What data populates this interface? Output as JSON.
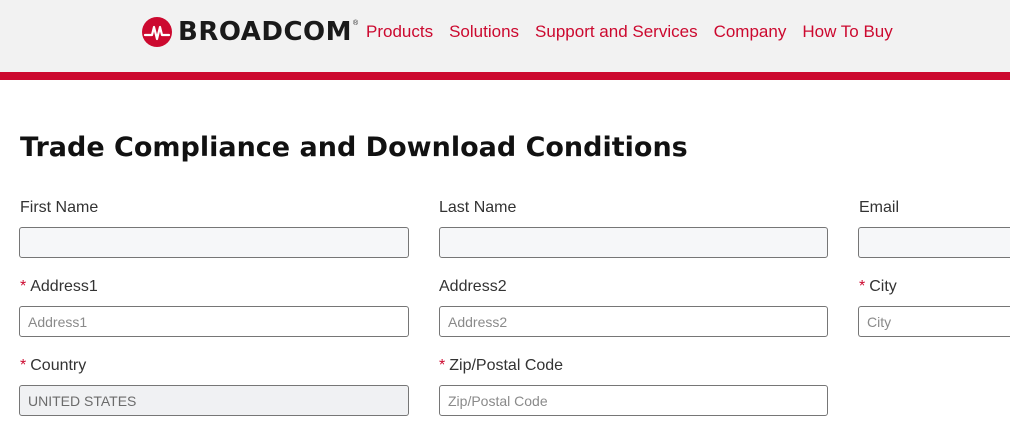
{
  "brand": {
    "name": "BROADCOM",
    "reg": "®",
    "accent": "#cc092f"
  },
  "nav": {
    "items": [
      {
        "label": "Products"
      },
      {
        "label": "Solutions"
      },
      {
        "label": "Support and Services"
      },
      {
        "label": "Company"
      },
      {
        "label": "How To Buy"
      }
    ]
  },
  "page": {
    "title": "Trade Compliance and Download Conditions"
  },
  "form": {
    "required_marker": "*",
    "first_name": {
      "label": "First Name",
      "value": "",
      "placeholder": ""
    },
    "last_name": {
      "label": "Last Name",
      "value": "",
      "placeholder": ""
    },
    "email": {
      "label": "Email",
      "value": "",
      "placeholder": ""
    },
    "address1": {
      "label": "Address1",
      "value": "",
      "placeholder": "Address1",
      "required": true
    },
    "address2": {
      "label": "Address2",
      "value": "",
      "placeholder": "Address2",
      "required": false
    },
    "city": {
      "label": "City",
      "value": "",
      "placeholder": "City",
      "required": true
    },
    "country": {
      "label": "Country",
      "value": "UNITED STATES",
      "required": true
    },
    "zip": {
      "label": "Zip/Postal Code",
      "value": "",
      "placeholder": "Zip/Postal Code",
      "required": true
    }
  }
}
